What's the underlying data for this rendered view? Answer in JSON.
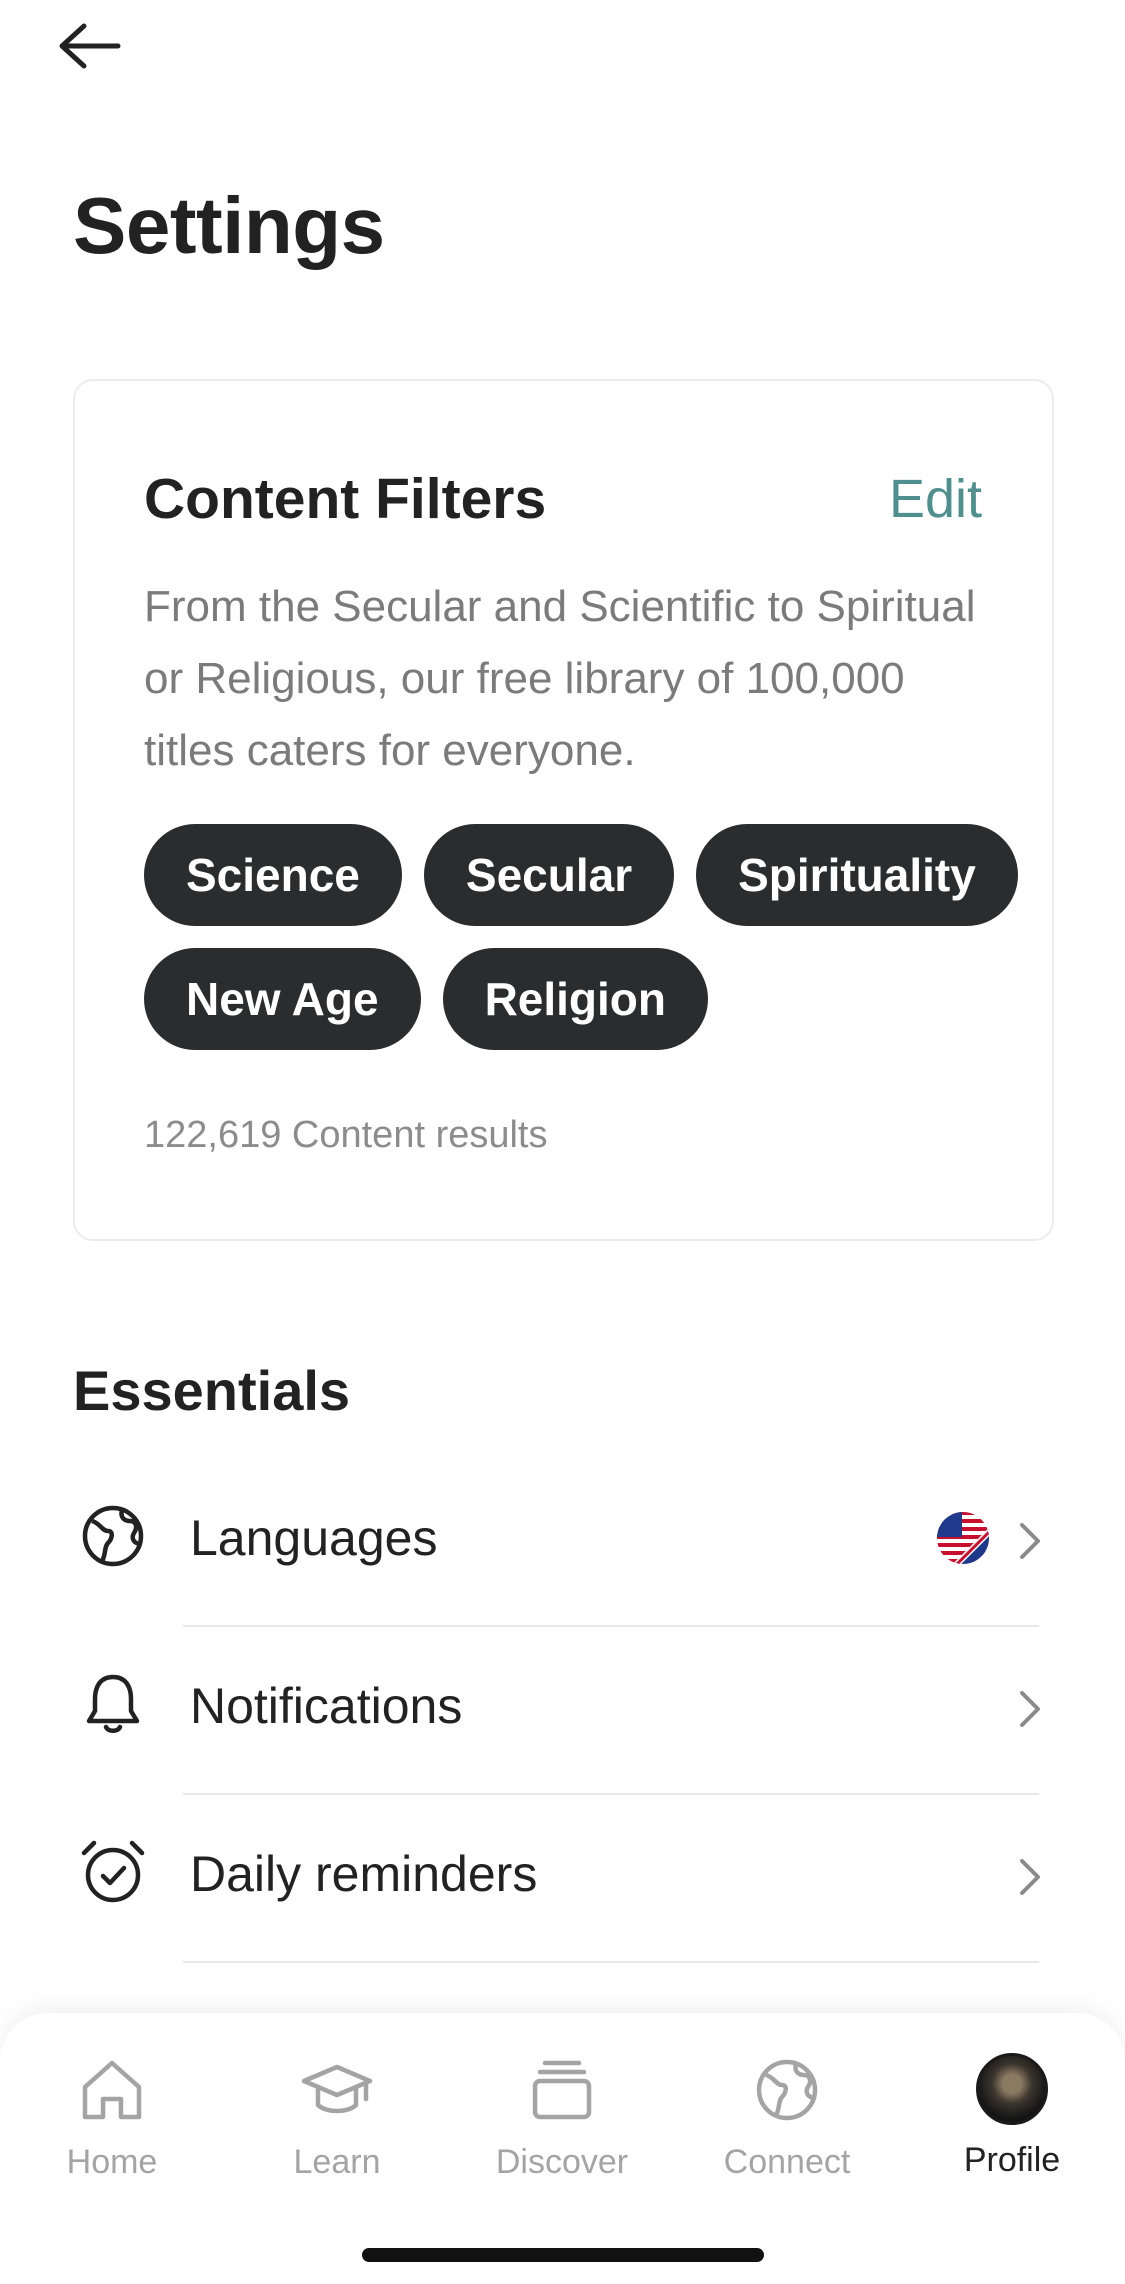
{
  "header": {
    "title": "Settings"
  },
  "content_filters": {
    "title": "Content Filters",
    "edit_label": "Edit",
    "description": "From the Secular and Scientific to Spiritual or Religious, our free library of 100,000 titles caters for everyone.",
    "chips": [
      "Science",
      "Secular",
      "Spirituality",
      "New Age",
      "Religion"
    ],
    "results": "122,619 Content results"
  },
  "essentials": {
    "title": "Essentials",
    "items": [
      {
        "label": "Languages",
        "icon": "globe-icon",
        "trailing": "flag-icon"
      },
      {
        "label": "Notifications",
        "icon": "bell-icon"
      },
      {
        "label": "Daily reminders",
        "icon": "alarm-clock-icon"
      }
    ]
  },
  "tabs": [
    {
      "label": "Home",
      "icon": "home-icon",
      "active": false
    },
    {
      "label": "Learn",
      "icon": "graduation-cap-icon",
      "active": false
    },
    {
      "label": "Discover",
      "icon": "stack-icon",
      "active": false
    },
    {
      "label": "Connect",
      "icon": "connect-globe-icon",
      "active": false
    },
    {
      "label": "Profile",
      "icon": "avatar",
      "active": true
    }
  ],
  "colors": {
    "accent": "#4f8f8d",
    "chip_bg": "#2b2c2e",
    "inactive": "#a4a4a4"
  }
}
